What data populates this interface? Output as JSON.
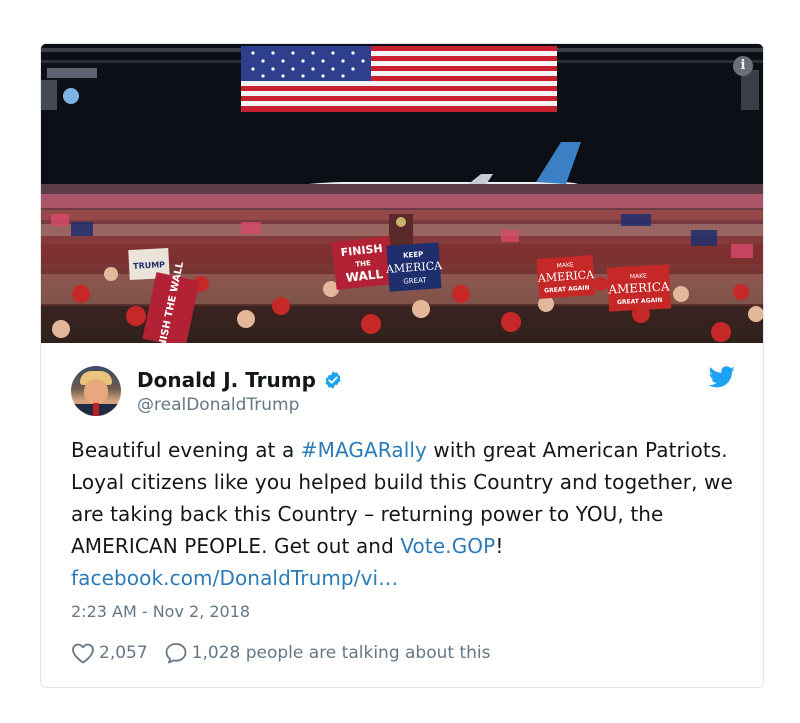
{
  "tweet": {
    "display_name": "Donald J. Trump",
    "handle": "@realDonaldTrump",
    "text_parts": {
      "p1": "Beautiful evening at a ",
      "hashtag": "#MAGARally",
      "p2": " with great American Patriots. Loyal citizens like you helped build this Country and together, we are taking back this Country – returning power to YOU, the AMERICAN PEOPLE. Get out and ",
      "link1": "Vote.GOP",
      "p3": "! ",
      "link2": "facebook.com/DonaldTrump/vi…"
    },
    "timestamp": "2:23 AM - Nov 2, 2018",
    "likes": "2,057",
    "talking": "1,028 people are talking about this"
  },
  "media": {
    "signs": {
      "finish_wall_1": "FINISH",
      "finish_wall_2": "THE",
      "finish_wall_3": "WALL",
      "keep_1": "KEEP",
      "keep_2": "AMERICA",
      "keep_3": "GREAT",
      "make_1": "MAKE",
      "make_2": "AMERICA",
      "make_3": "GREAT AGAIN",
      "trump": "TRUMP",
      "finish_vertical": "FINISH THE WALL"
    }
  },
  "icons": {
    "info": "info-icon",
    "verified": "verified-badge-icon",
    "bird": "twitter-bird-icon",
    "heart": "heart-icon",
    "comment": "comment-bubble-icon"
  },
  "colors": {
    "link": "#2b7bb9",
    "muted": "#657786",
    "verified": "#1da1f2",
    "card_border": "#e1e8ed"
  }
}
